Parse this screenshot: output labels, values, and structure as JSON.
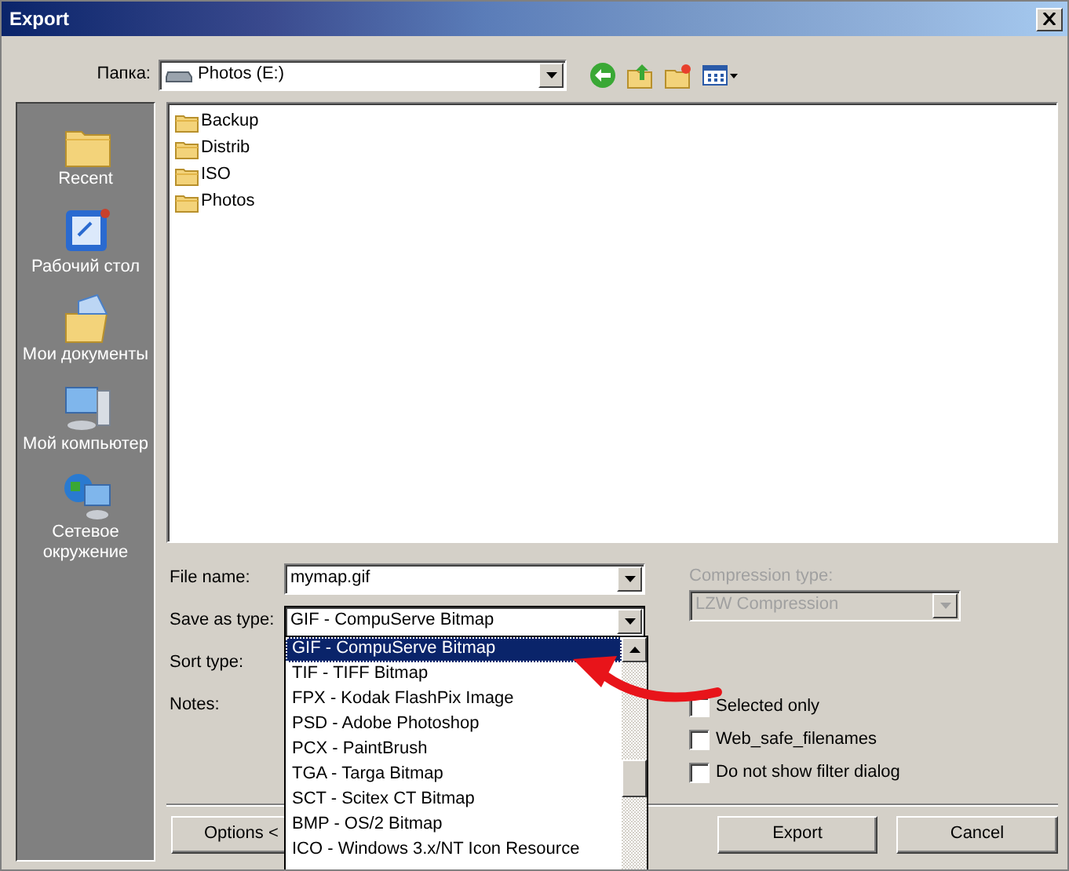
{
  "window": {
    "title": "Export"
  },
  "folder": {
    "label": "Папка:",
    "value": "Photos (E:)"
  },
  "places": [
    {
      "label": "Recent",
      "kind": "recent"
    },
    {
      "label": "Рабочий стол",
      "kind": "desktop"
    },
    {
      "label": "Мои документы",
      "kind": "documents"
    },
    {
      "label": "Мой компьютер",
      "kind": "computer"
    },
    {
      "label": "Сетевое окружение",
      "kind": "network"
    }
  ],
  "files": [
    {
      "name": "Backup"
    },
    {
      "name": "Distrib"
    },
    {
      "name": "ISO"
    },
    {
      "name": "Photos"
    }
  ],
  "file_name": {
    "label": "File name:",
    "value": "mymap.gif"
  },
  "save_as_type": {
    "label": "Save as type:",
    "value": "GIF - CompuServe Bitmap",
    "expanded": true,
    "options": [
      {
        "label": "GIF - CompuServe Bitmap",
        "selected": true
      },
      {
        "label": "TIF - TIFF Bitmap",
        "selected": false
      },
      {
        "label": "FPX - Kodak FlashPix Image",
        "selected": false
      },
      {
        "label": "PSD - Adobe Photoshop",
        "selected": false
      },
      {
        "label": "PCX - PaintBrush",
        "selected": false
      },
      {
        "label": "TGA - Targa Bitmap",
        "selected": false
      },
      {
        "label": "SCT - Scitex CT Bitmap",
        "selected": false
      },
      {
        "label": "BMP - OS/2 Bitmap",
        "selected": false
      },
      {
        "label": "ICO - Windows 3.x/NT Icon Resource",
        "selected": false
      }
    ]
  },
  "sort_type": {
    "label": "Sort type:"
  },
  "notes": {
    "label": "Notes:"
  },
  "compression": {
    "label": "Compression type:",
    "value": "LZW Compression",
    "disabled": true
  },
  "checkboxes": [
    {
      "label": "Selected only",
      "checked": false
    },
    {
      "label": "Web_safe_filenames",
      "checked": false
    },
    {
      "label": "Do not show filter dialog",
      "checked": false
    }
  ],
  "buttons": [
    {
      "label": "Options <"
    },
    {
      "label": "Export"
    },
    {
      "label": "Cancel"
    }
  ]
}
